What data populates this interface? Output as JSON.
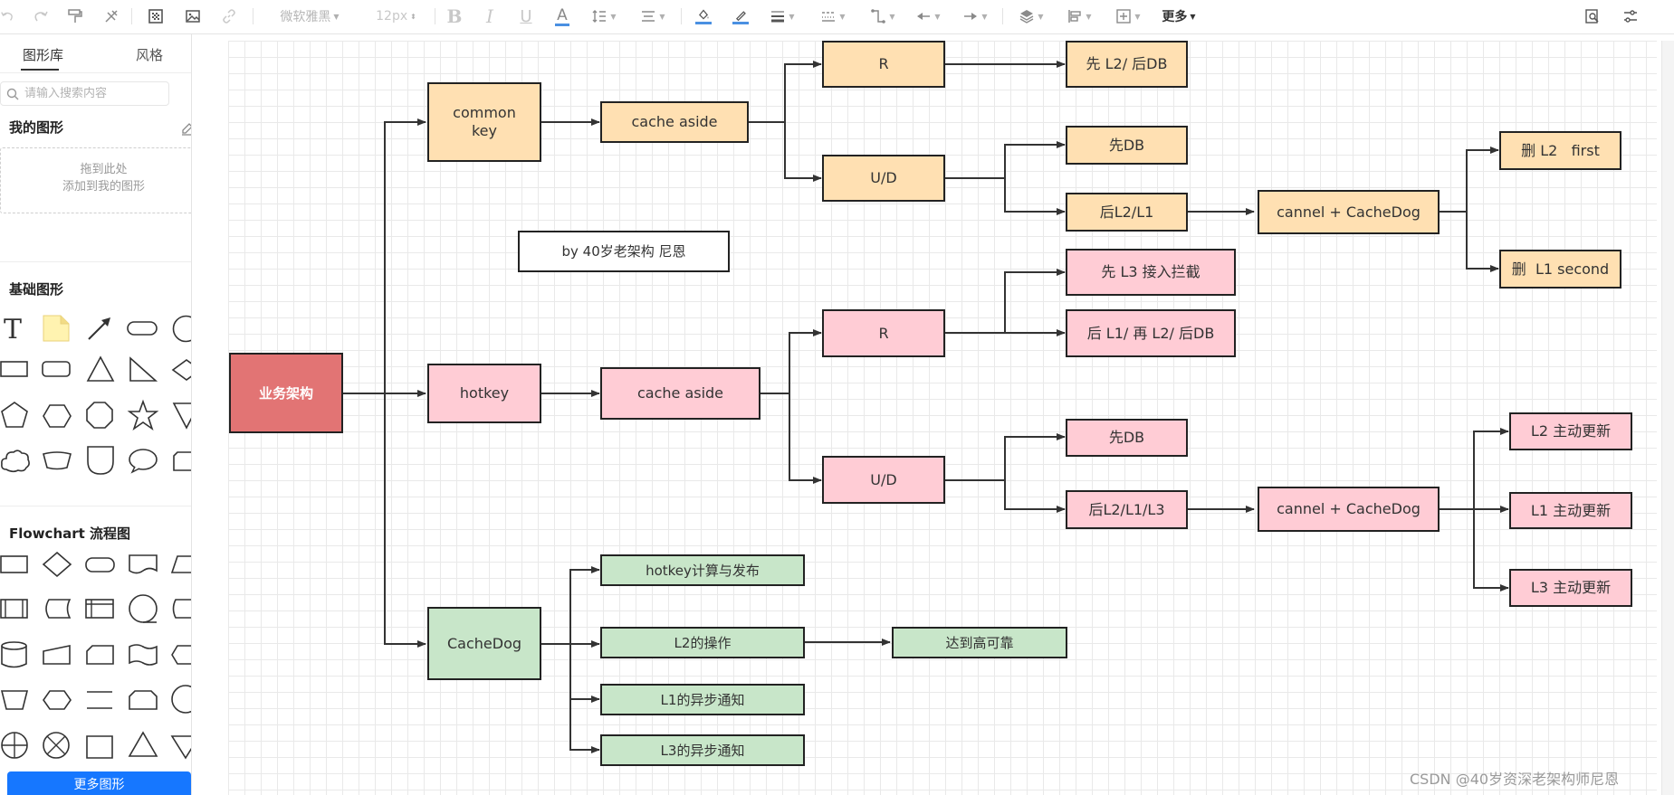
{
  "toolbar": {
    "font_family": "微软雅黑",
    "font_size": "12px",
    "more_label": "更多"
  },
  "sidebar": {
    "tabs": [
      "图形库",
      "风格"
    ],
    "search_placeholder": "请输入搜索内容",
    "my_shapes_title": "我的图形",
    "drop_hint_line1": "拖到此处",
    "drop_hint_line2": "添加到我的图形",
    "basic_shapes_title": "基础图形",
    "flowchart_title": "Flowchart 流程图",
    "more_shapes_button": "更多图形"
  },
  "diagram": {
    "root": "业务架构",
    "credit": "by 40岁老架构 尼恩",
    "common_key": {
      "label": "common\nkey",
      "strategy": "cache aside",
      "read": "R",
      "read_step": "先 L2/ 后DB",
      "update": "U/D",
      "update_step1": "先DB",
      "update_step2": "后L2/L1",
      "sync": "cannel + CacheDog",
      "delete1": "删 L2   first",
      "delete2": "删  L1 second"
    },
    "hotkey": {
      "label": "hotkey",
      "strategy": "cache aside",
      "read": "R",
      "read_step1": "先 L3 接入拦截",
      "read_step2": "后 L1/ 再 L2/ 后DB",
      "update": "U/D",
      "update_step1": "先DB",
      "update_step2": "后L2/L1/L3",
      "sync": "cannel + CacheDog",
      "refresh1": "L2 主动更新",
      "refresh2": "L1 主动更新",
      "refresh3": "L3 主动更新"
    },
    "cachedog": {
      "label": "CacheDog",
      "item1": "hotkey计算与发布",
      "item2": "L2的操作",
      "item2_result": "达到高可靠",
      "item3": "L1的异步通知",
      "item4": "L3的异步通知"
    }
  },
  "watermark": "CSDN @40岁资深老架构师尼恩"
}
